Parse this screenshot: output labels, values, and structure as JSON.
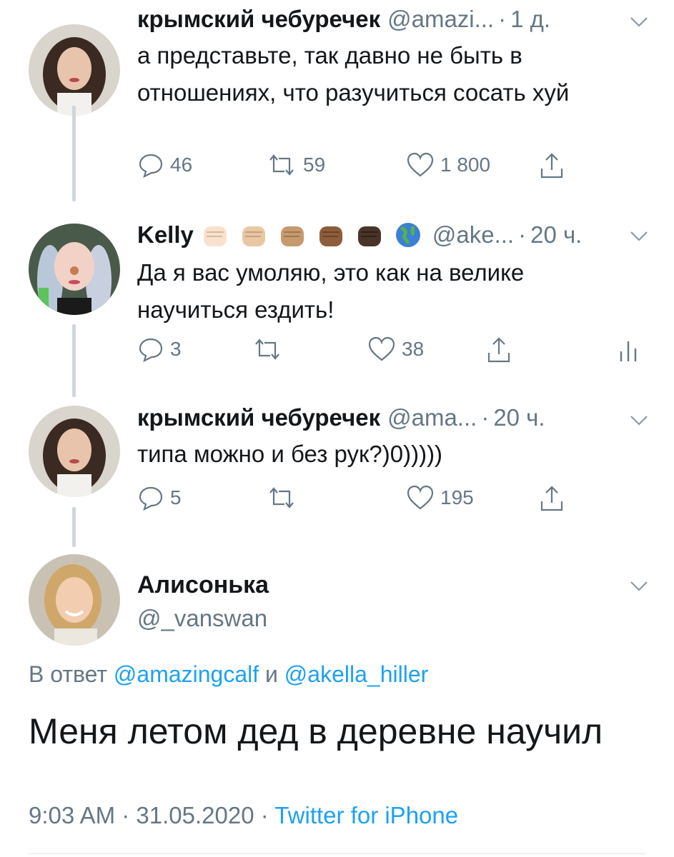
{
  "thread": [
    {
      "name": "крымский чебуречек",
      "handle": "@amazi...",
      "time": "1 д.",
      "text": "а представьте, так давно не быть в отношениях, что разучиться сосать хуй",
      "replies": "46",
      "retweets": "59",
      "likes": "1 800",
      "avatar_icon": "woman-dark-hair-avatar"
    },
    {
      "name": "Kelly",
      "handle": "@ake...",
      "time": "20 ч.",
      "emojis": [
        "raised-fist-light",
        "raised-fist-medium-light",
        "raised-fist-medium",
        "raised-fist-medium-dark",
        "raised-fist-dark",
        "globe-americas"
      ],
      "text": "Да я вас умоляю, это как на велике научиться ездить!",
      "replies": "3",
      "retweets": "",
      "likes": "38",
      "avatar_icon": "girl-clown-makeup-avatar"
    },
    {
      "name": "крымский чебуречек",
      "handle": "@ama...",
      "time": "20 ч.",
      "text": "типа можно и без рук?)0)))))",
      "replies": "5",
      "retweets": "",
      "likes": "195",
      "avatar_icon": "woman-dark-hair-avatar"
    }
  ],
  "main_tweet": {
    "name": "Алисонька",
    "handle": "@_vanswan",
    "reply_prefix": "В ответ",
    "reply_user1": "@amazingcalf",
    "reply_conj": "и",
    "reply_user2": "@akella_hiller",
    "text": "Меня летом дед в деревне научил",
    "time": "9:03 AM",
    "date": "31.05.2020",
    "source": "Twitter for iPhone",
    "avatar_icon": "blonde-woman-smiling-avatar"
  },
  "colors": {
    "text": "#14171a",
    "secondary": "#657786",
    "link": "#1da1f2",
    "thread_line": "#cfd6dc"
  }
}
